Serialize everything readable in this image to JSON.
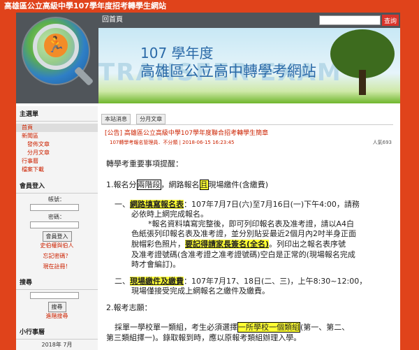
{
  "window": {
    "title": "高雄區公立高級中學107學年度招考轉學生網站"
  },
  "nav": {
    "home_label": "回首頁",
    "search_placeholder": "",
    "search_button": "查詢"
  },
  "banner": {
    "year_line": "107 學年度",
    "title_line": "高雄區公立高中轉學考網站",
    "bg_text": "TRANSFER EXAM"
  },
  "sidebar": {
    "main_menu_title": "主選單",
    "menu_items": [
      "首頁",
      "新聞區",
      "發佈文章",
      "分月文章",
      "行事曆",
      "檔案下載"
    ],
    "login_title": "會員登入",
    "account_label": "帳號：",
    "password_label": "密碼：",
    "login_button": "會員登入",
    "links": [
      "史伯權與伯人",
      "忘記密碼？",
      "現在註冊！"
    ],
    "search_title": "搜尋",
    "search_button": "搜尋",
    "advanced_search": "進階搜尋",
    "calendar_title": "小行事曆",
    "calendar_month": "2018年 7月"
  },
  "main": {
    "tabs": [
      "本站消息",
      "分月文章"
    ],
    "article": {
      "title": "[公告] 高雄區公立高級中學107學年度聯合招考轉學生簡章",
      "meta": "107轉學考報名管理員．不分類 | 2018-06-15 16:23:45",
      "views": "人氣693"
    },
    "body": {
      "intro": "轉學考重要事項提醒：",
      "s1_pre": "1.報名分",
      "s1_box": "兩階段",
      "s1_mid": "，網路報名",
      "s1_box2": "且",
      "s1_post": "現場繳件(含繳費)",
      "s1a_label": "一、",
      "s1a_highlight": "網路填寫報名表",
      "s1a_text": "：107年7月7日(六)至7月16日(一)下午4:00，請務",
      "s1a_text2": "必依時上網完成報名。",
      "s1a_note1": "*報名資料填寫完整後，即可列印報名表及准考證，請以A4白",
      "s1a_note2": "色紙張列印報名表及准考證，並分別貼妥最近2個月內2吋半身正面",
      "s1a_note3_pre": "脫帽彩色照片，",
      "s1a_note3_highlight": "要記得請家長簽名(全名)",
      "s1a_note3_post": "。列印出之報名表序號",
      "s1a_note4": "及准考證號碼(含准考證之准考證號碼)空白是正常的(現場報名完成",
      "s1a_note5": "時才會編訂)。",
      "s1b_label": "二、",
      "s1b_highlight": "現場繳件及繳費",
      "s1b_text": "：107年7月17、18日(二、三)，上午8:30~12:00，",
      "s1b_text2": "現場僅接受完成上網報名之繳件及繳費。",
      "s2": "2.報考志願：",
      "s2_text_pre": "採單一學校單一類組，考生必須選擇",
      "s2_highlight": "一所學校一個類組",
      "s2_text_post": "(第一、第二、",
      "s2_text2": "第三類組擇一)。錄取報到時，應以原報考類組辦理入學。"
    }
  }
}
